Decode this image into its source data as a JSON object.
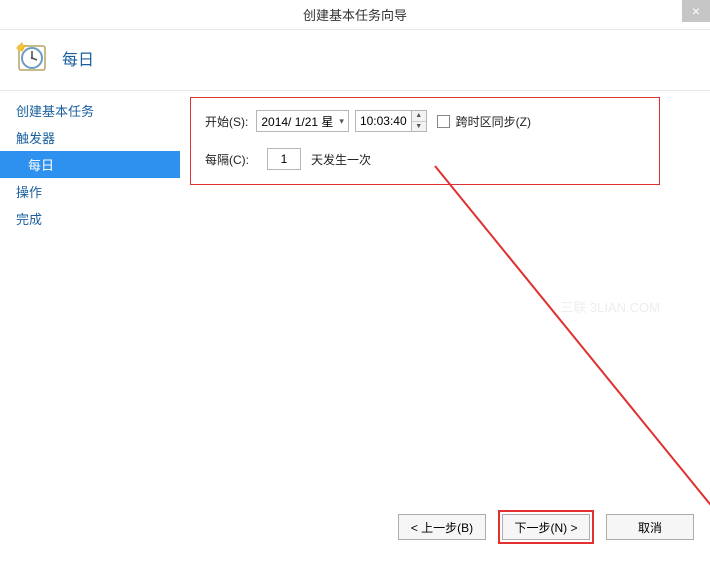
{
  "window": {
    "title": "创建基本任务向导",
    "close": "×"
  },
  "header": {
    "page_title": "每日"
  },
  "sidebar": {
    "items": [
      {
        "label": "创建基本任务",
        "indent": false,
        "selected": false
      },
      {
        "label": "触发器",
        "indent": false,
        "selected": false
      },
      {
        "label": "每日",
        "indent": true,
        "selected": true
      },
      {
        "label": "操作",
        "indent": false,
        "selected": false
      },
      {
        "label": "完成",
        "indent": false,
        "selected": false
      }
    ]
  },
  "form": {
    "start_label": "开始(S):",
    "date_value": "2014/ 1/21 星",
    "time_value": "10:03:40",
    "sync_tz_label": "跨时区同步(Z)",
    "interval_label": "每隔(C):",
    "interval_value": "1",
    "interval_suffix": "天发生一次"
  },
  "footer": {
    "back": "< 上一步(B)",
    "next": "下一步(N) >",
    "cancel": "取消"
  },
  "watermark": "三联 3LIAN.COM"
}
